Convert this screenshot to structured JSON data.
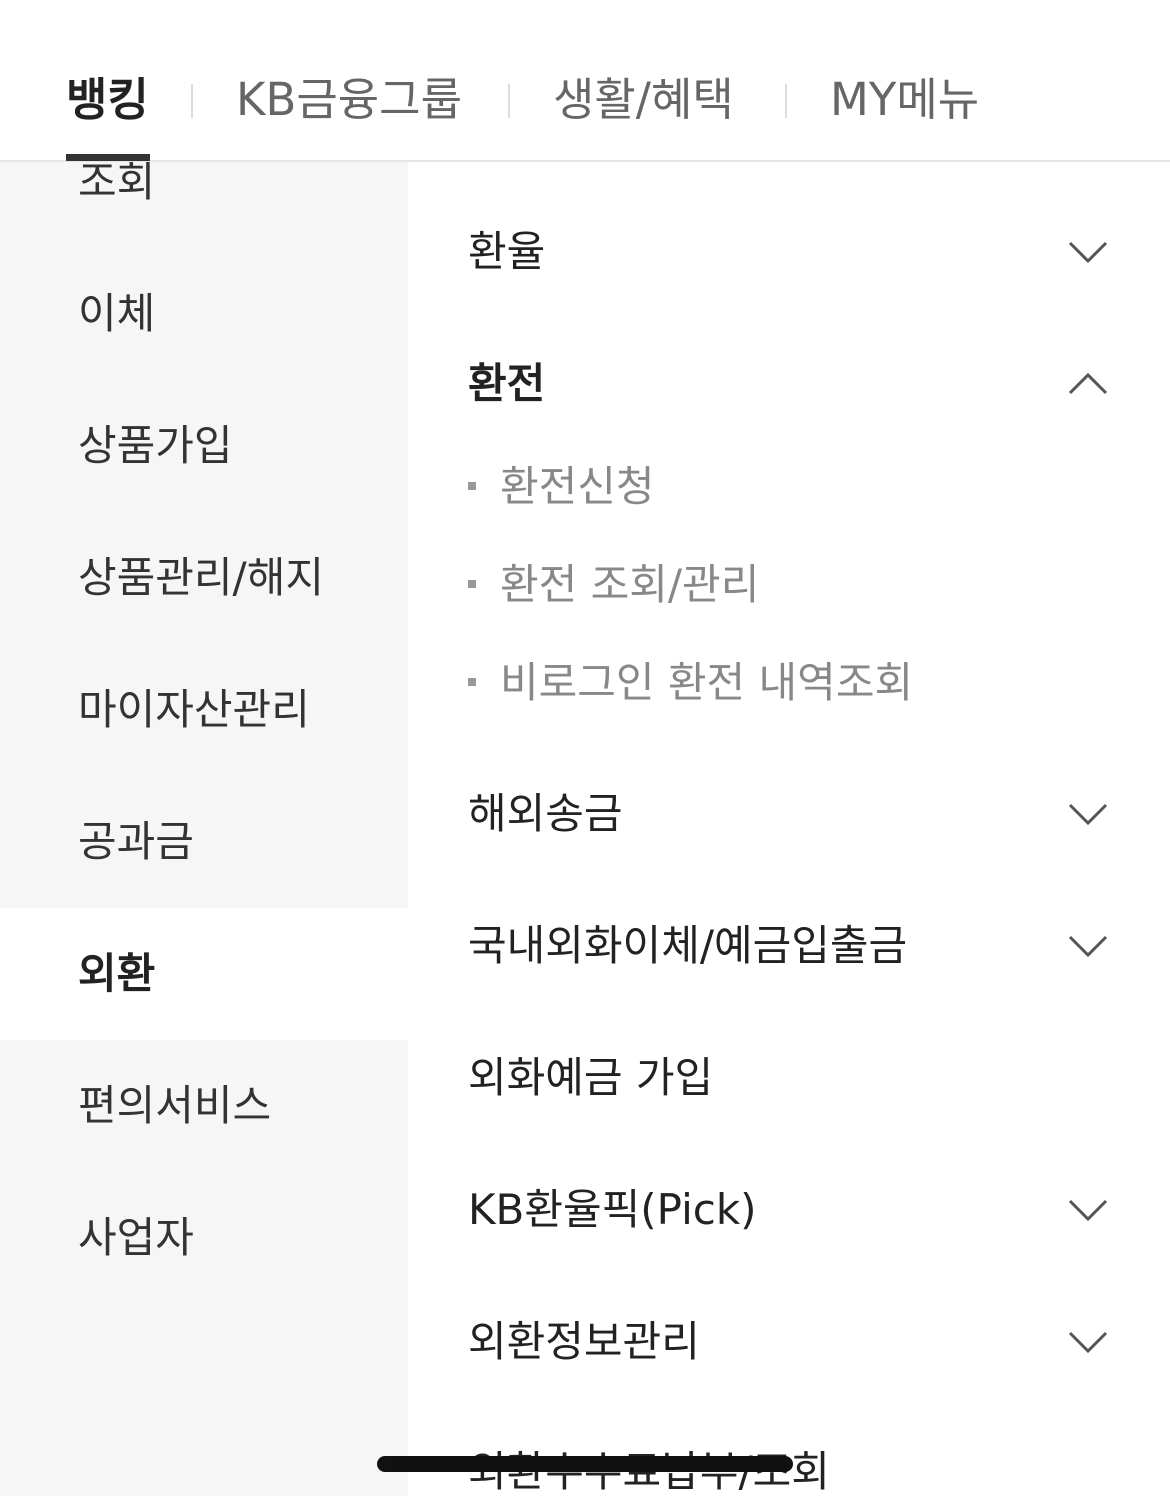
{
  "top_tabs": [
    {
      "label": "뱅킹",
      "active": true
    },
    {
      "label": "KB금융그룹",
      "active": false
    },
    {
      "label": "생활/혜택",
      "active": false
    },
    {
      "label": "MY메뉴",
      "active": false
    }
  ],
  "left_menu": [
    {
      "label": "조회"
    },
    {
      "label": "이체"
    },
    {
      "label": "상품가입"
    },
    {
      "label": "상품관리/해지"
    },
    {
      "label": "마이자산관리"
    },
    {
      "label": "공과금"
    },
    {
      "label": "외환",
      "active": true
    },
    {
      "label": "편의서비스"
    },
    {
      "label": "사업자"
    }
  ],
  "right_menu": [
    {
      "label": "환율",
      "state": "chevron-down-icon"
    },
    {
      "label": "환전",
      "state": "chevron-up-icon",
      "children": [
        {
          "label": "환전신청"
        },
        {
          "label": "환전 조회/관리"
        },
        {
          "label": "비로그인 환전 내역조회"
        }
      ]
    },
    {
      "label": "해외송금",
      "state": "chevron-down-icon"
    },
    {
      "label": "국내외화이체/예금입출금",
      "state": "chevron-down-icon"
    },
    {
      "label": "외화예금 가입"
    },
    {
      "label": "KB환율픽(Pick)",
      "state": "chevron-down-icon"
    },
    {
      "label": "외환정보관리",
      "state": "chevron-down-icon"
    },
    {
      "label": "외환수수료납부/조회"
    }
  ]
}
